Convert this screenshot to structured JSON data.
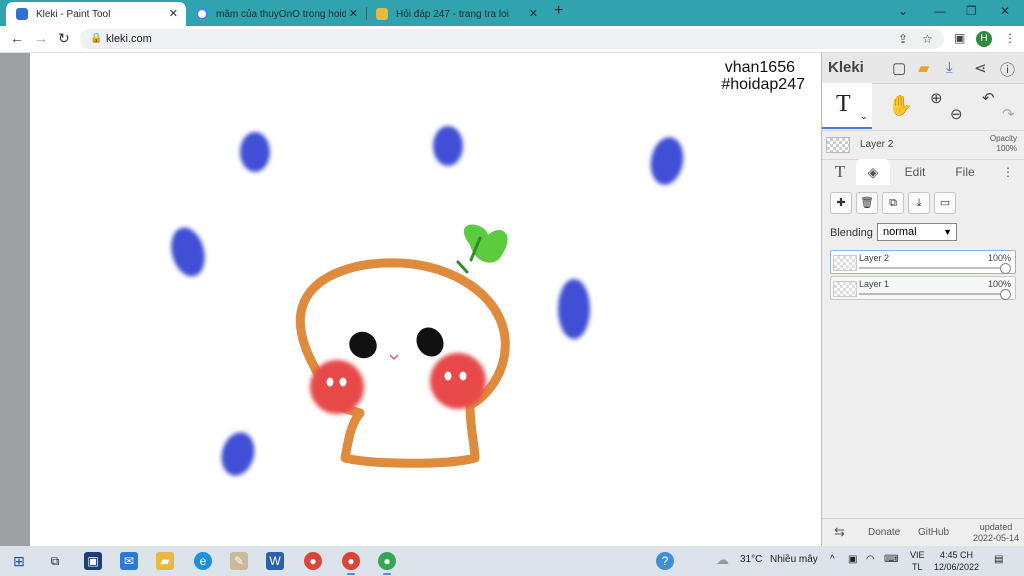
{
  "browser": {
    "tabs": [
      {
        "title": "Kleki - Paint Tool",
        "favicon_color": "#2f6fd6",
        "active": true
      },
      {
        "title": "mâm của thuyOnO trong hoidap",
        "favicon_color": "#4285f4",
        "active": false
      },
      {
        "title": "Hỏi đáp 247 - trang tra loi",
        "favicon_color": "#e9b93b",
        "active": false
      }
    ],
    "new_tab": "+",
    "url": "kleki.com",
    "profile_initial": "H"
  },
  "canvas": {
    "watermark_line1": "vhan1656",
    "watermark_line2": "#hoidap247"
  },
  "kleki": {
    "logo": "Kleki",
    "tool_glyph": "T",
    "layer_name": "Layer 2",
    "opacity_label": "Opacity",
    "opacity_value": "100%",
    "tabs": {
      "text": "T",
      "edit": "Edit",
      "file": "File"
    },
    "blending_label": "Blending",
    "blending_value": "normal",
    "layers": [
      {
        "name": "Layer 2",
        "opacity": "100%",
        "active": true
      },
      {
        "name": "Layer 1",
        "opacity": "100%",
        "active": false
      }
    ],
    "footer": {
      "donate": "Donate",
      "github": "GitHub",
      "updated_label": "updated",
      "updated_date": "2022-05-14"
    }
  },
  "taskbar": {
    "weather": "31°C",
    "weather_desc": "Nhiều mây",
    "lang_line1": "VIE",
    "lang_line2": "TL",
    "time": "4:45 CH",
    "date": "12/06/2022"
  }
}
